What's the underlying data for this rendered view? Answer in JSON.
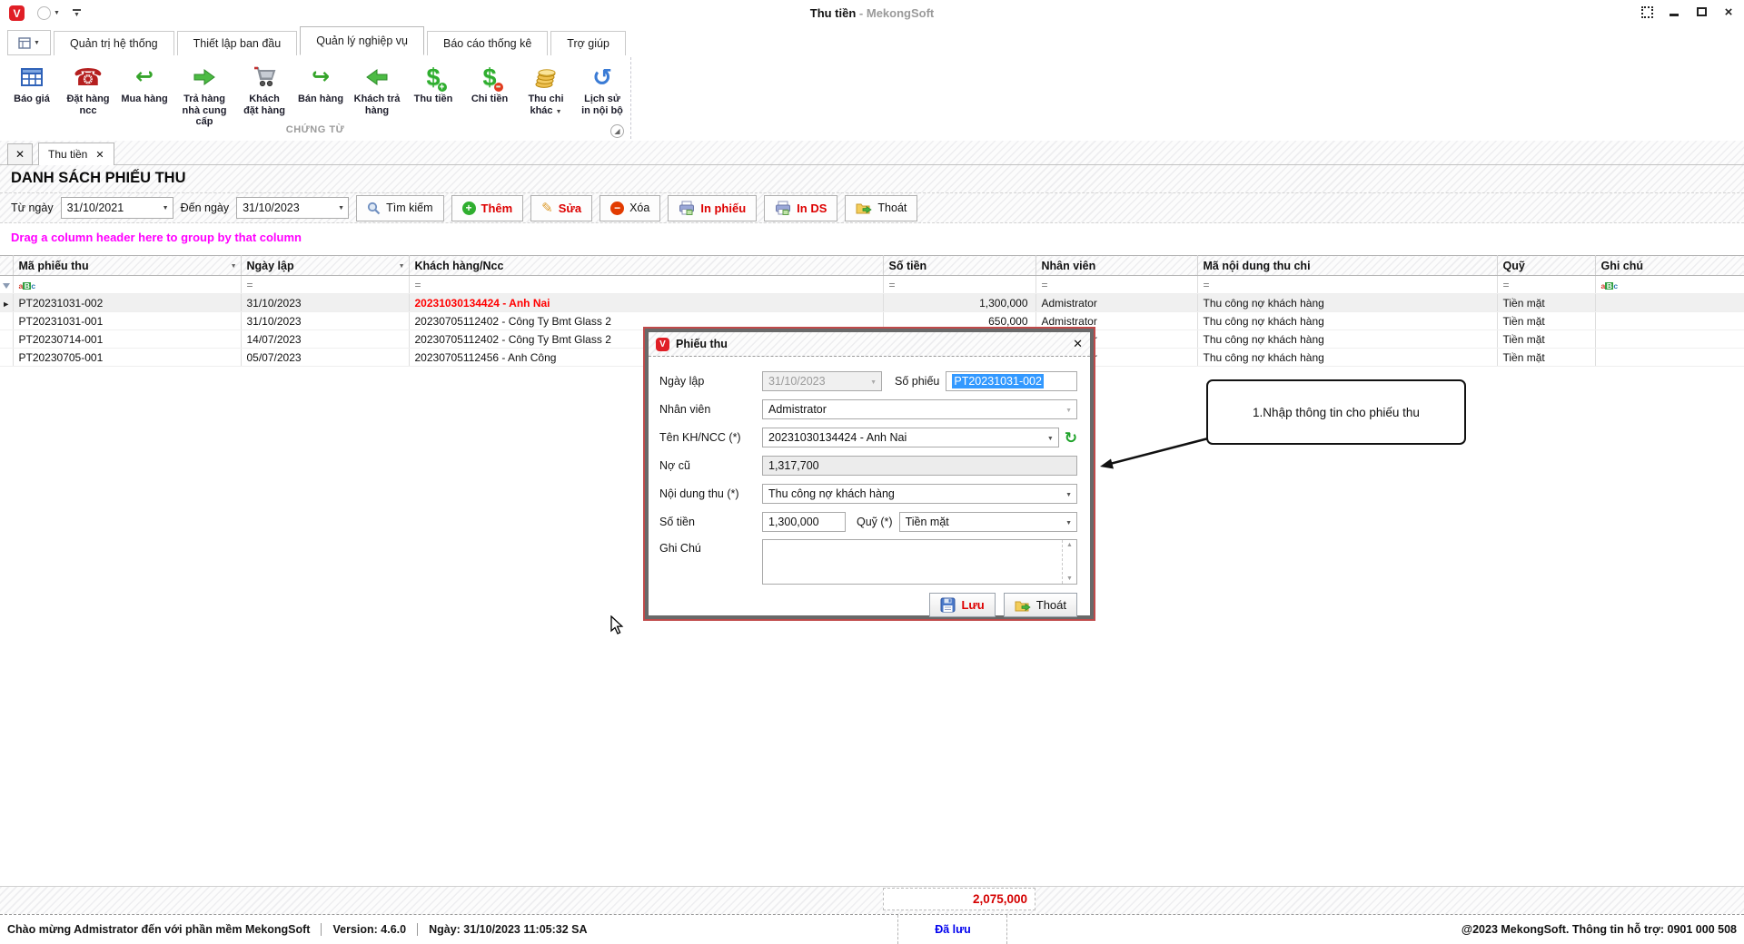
{
  "window": {
    "title": "Thu tiền",
    "subtitle": "- MekongSoft"
  },
  "ribbon": {
    "tabs": [
      {
        "label": "Quản trị hệ thống"
      },
      {
        "label": "Thiết lập ban đầu"
      },
      {
        "label": "Quản lý nghiệp vụ"
      },
      {
        "label": "Báo cáo thống kê"
      },
      {
        "label": "Trợ giúp"
      }
    ],
    "active_tab": "Quản lý nghiệp vụ",
    "group_label": "CHỨNG TỪ",
    "buttons": [
      {
        "label": "Báo giá",
        "icon": "table-icon"
      },
      {
        "label": "Đặt hàng ncc",
        "icon": "phone-icon"
      },
      {
        "label": "Mua hàng",
        "icon": "curved-arrow-left-icon"
      },
      {
        "label": "Trả hàng nhà cung cấp",
        "icon": "arrow-right-icon"
      },
      {
        "label": "Khách đặt hàng",
        "icon": "cart-icon"
      },
      {
        "label": "Bán hàng",
        "icon": "curved-arrow-right-icon"
      },
      {
        "label": "Khách trả hàng",
        "icon": "arrow-left-icon"
      },
      {
        "label": "Thu tiền",
        "icon": "dollar-plus-icon"
      },
      {
        "label": "Chi tiền",
        "icon": "dollar-minus-icon"
      },
      {
        "label": "Thu chi khác",
        "icon": "coins-icon",
        "caret": "▼"
      },
      {
        "label": "Lịch sử in nội bộ",
        "icon": "history-icon"
      }
    ]
  },
  "tabstrip": {
    "active_tab": "Thu tiền",
    "close_glyph": "✕"
  },
  "page": {
    "title": "DANH SÁCH PHIẾU THU",
    "group_hint": "Drag a column header here to group by that column"
  },
  "filterbar": {
    "from_label": "Từ ngày",
    "from_value": "31/10/2021",
    "to_label": "Đến ngày",
    "to_value": "31/10/2023",
    "buttons": [
      {
        "label": "Tìm kiếm",
        "icon": "search-icon",
        "emphasis": false
      },
      {
        "label": "Thêm",
        "icon": "plus-circle-icon",
        "emphasis": true
      },
      {
        "label": "Sửa",
        "icon": "pencil-icon",
        "emphasis": true
      },
      {
        "label": "Xóa",
        "icon": "stop-circle-icon",
        "emphasis": false
      },
      {
        "label": "In phiếu",
        "icon": "printer-icon",
        "emphasis": true
      },
      {
        "label": "In DS",
        "icon": "printer-icon",
        "emphasis": true
      },
      {
        "label": "Thoát",
        "icon": "exit-folder-icon",
        "emphasis": false
      }
    ]
  },
  "table": {
    "columns": [
      "Mã phiếu thu",
      "Ngày lập",
      "Khách hàng/Ncc",
      "Số tiền",
      "Nhân viên",
      "Mã nội dung thu chi",
      "Quỹ",
      "Ghi chú"
    ],
    "filter_eq": "=",
    "rows": [
      {
        "ma": "PT20231031-002",
        "ngay": "31/10/2023",
        "kh": "20231030134424 - Anh Nai",
        "tien": "1,300,000",
        "nv": "Admistrator",
        "nd": "Thu công nợ khách hàng",
        "quy": "Tiền mặt",
        "ghi": ""
      },
      {
        "ma": "PT20231031-001",
        "ngay": "31/10/2023",
        "kh": "20230705112402 - Công Ty Bmt Glass 2",
        "tien": "650,000",
        "nv": "Admistrator",
        "nd": "Thu công nợ khách hàng",
        "quy": "Tiền mặt",
        "ghi": ""
      },
      {
        "ma": "PT20230714-001",
        "ngay": "14/07/2023",
        "kh": "20230705112402 - Công Ty Bmt Glass 2",
        "tien": "",
        "nv": "Admistrator",
        "nd": "Thu công nợ khách hàng",
        "quy": "Tiền mặt",
        "ghi": ""
      },
      {
        "ma": "PT20230705-001",
        "ngay": "05/07/2023",
        "kh": "20230705112456 - Anh Công",
        "tien": "",
        "nv": "Admistrator",
        "nd": "Thu công nợ khách hàng",
        "quy": "Tiền mặt",
        "ghi": ""
      }
    ],
    "total": "2,075,000"
  },
  "dialog": {
    "title": "Phiếu thu",
    "fields": {
      "ngay_lap": {
        "label": "Ngày lập",
        "value": "31/10/2023"
      },
      "so_phieu": {
        "label": "Số phiếu",
        "value": "PT20231031-002"
      },
      "nhan_vien": {
        "label": "Nhân viên",
        "value": "Admistrator"
      },
      "ten_kh": {
        "label": "Tên KH/NCC (*)",
        "value": "20231030134424 - Anh Nai"
      },
      "no_cu": {
        "label": "Nợ cũ",
        "value": "1,317,700"
      },
      "noi_dung": {
        "label": "Nội dung thu (*)",
        "value": "Thu công nợ khách hàng"
      },
      "so_tien": {
        "label": "Số tiền",
        "value": "1,300,000"
      },
      "quy": {
        "label": "Quỹ (*)",
        "value": "Tiền mặt"
      },
      "ghi_chu": {
        "label": "Ghi Chú",
        "value": ""
      }
    },
    "buttons": {
      "save": "Lưu",
      "exit": "Thoát"
    }
  },
  "annotation": {
    "text": "1.Nhập thông tin cho phiếu thu"
  },
  "statusbar": {
    "welcome": "Chào mừng Admistrator đến với phần mềm MekongSoft",
    "version": "Version: 4.6.0",
    "date": "Ngày: 31/10/2023 11:05:32 SA",
    "saved": "Đã lưu",
    "copyright": "@2023 MekongSoft. Thông tin hỗ trợ: 0901 000 508"
  },
  "colors": {
    "accent_red": "#dd0000",
    "group_hint_magenta": "#ff00ff",
    "highlight_yellow": "#ffff8c",
    "highlight_text_red": "#ff0000",
    "selection_blue": "#3399ff",
    "saved_blue": "#0000ee",
    "logo_red": "#e01f26",
    "dialog_border_red": "#c04a4a"
  }
}
